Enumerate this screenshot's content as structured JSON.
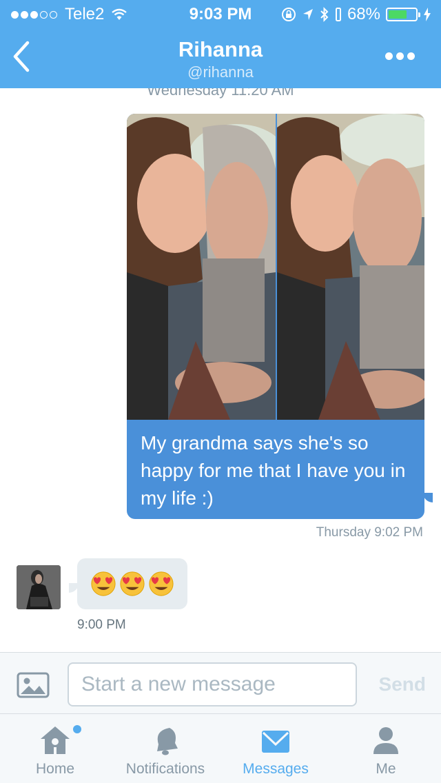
{
  "status_bar": {
    "carrier": "Tele2",
    "time": "9:03 PM",
    "battery": "68%",
    "battery_level": 0.68
  },
  "header": {
    "title": "Rihanna",
    "handle": "@rihanna",
    "back_icon": "chevron-left-icon",
    "more_icon": "more-dots-icon",
    "background": "#55acee"
  },
  "conversation": {
    "divider_date": "Wednesday 11:20 AM",
    "outgoing": {
      "text": "My grandma says she's so happy for me that I have you in my life :)",
      "time": "Thursday 9:02 PM",
      "bubble_color": "#4a90d9"
    },
    "incoming": {
      "emojis": [
        "heart-eyes",
        "heart-eyes",
        "heart-eyes"
      ],
      "time": "9:00 PM",
      "bubble_color": "#e6ecf0"
    }
  },
  "composer": {
    "placeholder": "Start a new message",
    "send_label": "Send"
  },
  "tabs": [
    {
      "label": "Home",
      "icon": "home-icon",
      "active": false,
      "has_dot": true
    },
    {
      "label": "Notifications",
      "icon": "bell-icon",
      "active": false
    },
    {
      "label": "Messages",
      "icon": "envelope-icon",
      "active": true
    },
    {
      "label": "Me",
      "icon": "person-icon",
      "active": false
    }
  ],
  "colors": {
    "accent": "#55acee",
    "inactive": "#8899a6"
  }
}
